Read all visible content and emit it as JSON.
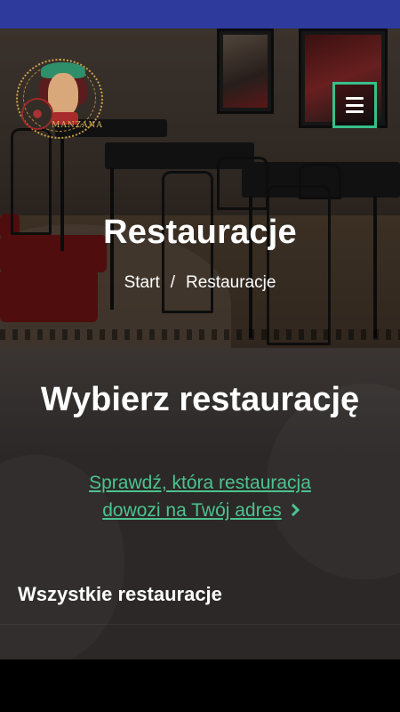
{
  "header": {
    "logo_brand": "MANZANA",
    "menu_icon": "hamburger-menu-icon"
  },
  "hero": {
    "title": "Restauracje",
    "breadcrumb": {
      "start": "Start",
      "separator": "/",
      "current": "Restauracje"
    }
  },
  "main": {
    "choose_title": "Wybierz restaurację",
    "check_link_line1": "Sprawdź, która restauracja",
    "check_link_line2": "dowozi na Twój adres",
    "check_link_icon": "chevron-right-icon",
    "all_restaurants_title": "Wszystkie restauracje"
  },
  "colors": {
    "accent": "#4cc38f",
    "status_bar": "#2e3b9c",
    "content_bg": "#2b2827"
  }
}
